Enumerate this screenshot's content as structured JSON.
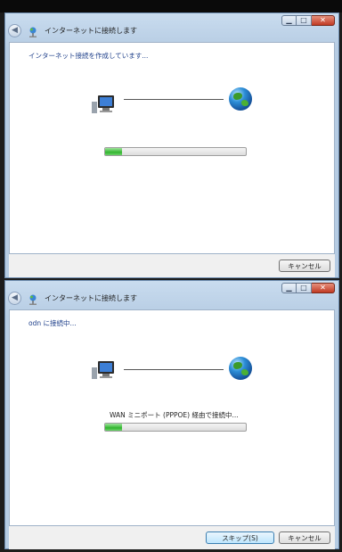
{
  "window1": {
    "title": "インターネットに接続します",
    "status": "インターネット接続を作成しています...",
    "progress": 0.12,
    "cancel_label": "キャンセル"
  },
  "window2": {
    "title": "インターネットに接続します",
    "status": "odn に接続中...",
    "substatus": "WAN ミニポート (PPPOE) 経由で接続中...",
    "progress": 0.12,
    "skip_label": "スキップ(S)",
    "cancel_label": "キャンセル"
  },
  "icons": [
    "back-arrow-icon",
    "network-connection-icon",
    "computer-icon",
    "globe-icon",
    "minimize-icon",
    "maximize-icon",
    "close-icon"
  ],
  "colors": {
    "status_text": "#1e3f8a",
    "progress_fill": "#32b52f",
    "close_button": "#c13a24"
  }
}
